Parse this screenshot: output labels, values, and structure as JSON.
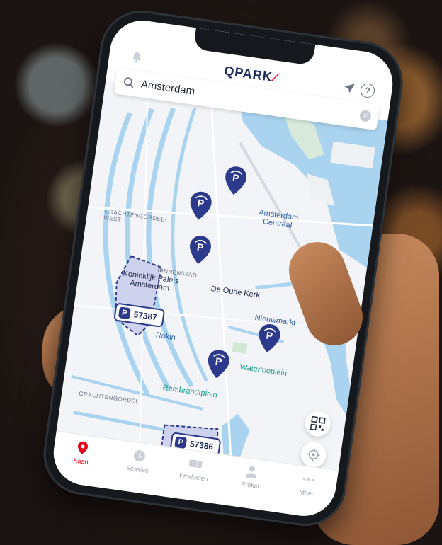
{
  "header": {
    "brand": "QPARK",
    "brand_slash": "⁄"
  },
  "search": {
    "value": "Amsterdam"
  },
  "map_labels": {
    "amsterdam_centraal": "Amsterdam\nCentraal",
    "grachtengordel_west": "GRACHTENGORDEL-\nWEST",
    "binnenstad": "BINNENSTAD",
    "koninklijk_paleis": "Koninklijk Paleis\nAmsterdam",
    "oude_kerk": "De Oude Kerk",
    "nieuwmarkt": "Nieuwmarkt",
    "rokin": "Rokin",
    "waterlooplein": "Waterlooplein",
    "rembrandtplein": "Rembrandtplein",
    "grachtengordel": "GRACHTENGORDEL"
  },
  "lots": [
    {
      "id": "57387"
    },
    {
      "id": "57386"
    }
  ],
  "lot_symbol": "P",
  "tabs": [
    {
      "label": "Kaart",
      "icon": "map-pin-icon",
      "active": true
    },
    {
      "label": "Sessies",
      "icon": "clock-icon",
      "active": false
    },
    {
      "label": "Producten",
      "icon": "ticket-icon",
      "active": false
    },
    {
      "label": "Profiel",
      "icon": "person-icon",
      "active": false
    },
    {
      "label": "Meer",
      "icon": "more-icon",
      "active": false
    }
  ],
  "colors": {
    "brand": "#e2001a",
    "pin": "#2d3a8c",
    "water": "#a9d3ee",
    "land": "#f2f4f7"
  }
}
